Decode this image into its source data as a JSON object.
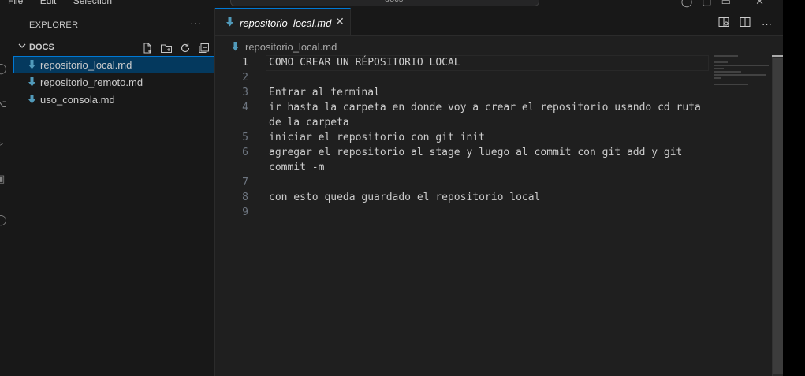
{
  "titlebar": {
    "menu": [
      "File",
      "Edit",
      "Selection"
    ],
    "search_text": "docs"
  },
  "sidebar": {
    "title": "EXPLORER",
    "more": "···",
    "folder": "DOCS",
    "files": [
      {
        "name": "repositorio_local.md",
        "selected": true
      },
      {
        "name": "repositorio_remoto.md",
        "selected": false
      },
      {
        "name": "uso_consola.md",
        "selected": false
      }
    ]
  },
  "editor": {
    "tab": {
      "label": "repositorio_local.md",
      "close": "✕"
    },
    "breadcrumb": "repositorio_local.md",
    "lines": [
      {
        "n": "1",
        "text": "COMO CREAR UN RÉPOSITORIO LOCAL"
      },
      {
        "n": "2",
        "text": ""
      },
      {
        "n": "3",
        "text": "Entrar al terminal"
      },
      {
        "n": "4",
        "text": "ir hasta la carpeta en donde voy a crear el repositorio usando cd ruta"
      },
      {
        "n": "",
        "text": "de la carpeta"
      },
      {
        "n": "5",
        "text": "iniciar el repositorio con git init"
      },
      {
        "n": "6",
        "text": "agregar el repositorio al stage y luego al commit con git add y git"
      },
      {
        "n": "",
        "text": "commit -m"
      },
      {
        "n": "7",
        "text": ""
      },
      {
        "n": "8",
        "text": "con esto queda guardado el repositorio local"
      },
      {
        "n": "9",
        "text": ""
      }
    ],
    "actions_more": "···"
  },
  "colors": {
    "accent": "#0078d4",
    "selection": "#04395e",
    "md_icon": "#519aba"
  }
}
